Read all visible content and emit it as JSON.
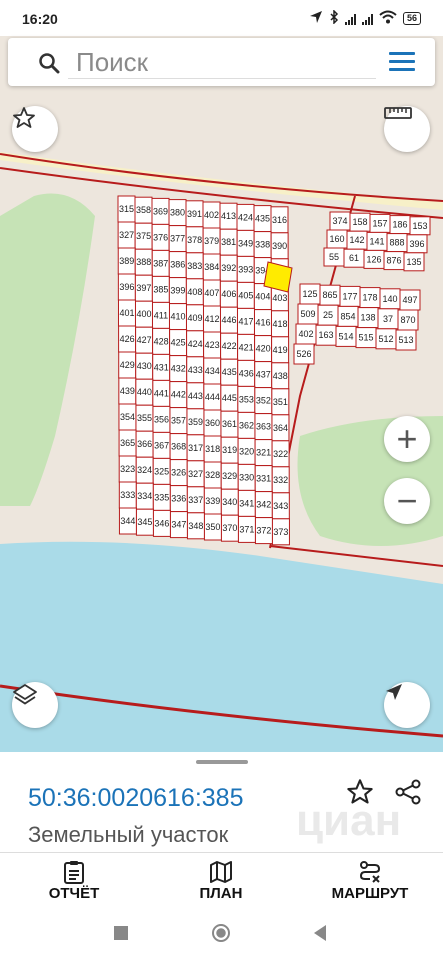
{
  "status": {
    "time": "16:20",
    "battery": "56"
  },
  "search": {
    "placeholder": "Поиск"
  },
  "map": {
    "zoom_in": "+",
    "zoom_out": "−",
    "parcels": [
      "315",
      "358",
      "369",
      "380",
      "391",
      "402",
      "413",
      "424",
      "435",
      "316",
      "327",
      "375",
      "376",
      "377",
      "378",
      "379",
      "381",
      "349",
      "338",
      "390",
      "389",
      "388",
      "387",
      "386",
      "383",
      "384",
      "392",
      "393",
      "394",
      "395",
      "396",
      "397",
      "385",
      "399",
      "408",
      "407",
      "406",
      "405",
      "404",
      "403",
      "401",
      "400",
      "411",
      "410",
      "409",
      "412",
      "446",
      "417",
      "416",
      "418",
      "426",
      "427",
      "428",
      "425",
      "424",
      "423",
      "422",
      "421",
      "420",
      "419",
      "429",
      "430",
      "431",
      "432",
      "433",
      "434",
      "435",
      "436",
      "437",
      "438",
      "439",
      "440",
      "441",
      "442",
      "443",
      "444",
      "445",
      "353",
      "352",
      "351",
      "354",
      "355",
      "356",
      "357",
      "359",
      "360",
      "361",
      "362",
      "363",
      "364",
      "365",
      "366",
      "367",
      "368",
      "317",
      "318",
      "319",
      "320",
      "321",
      "322",
      "323",
      "324",
      "325",
      "326",
      "327",
      "328",
      "329",
      "330",
      "331",
      "332",
      "333",
      "334",
      "335",
      "336",
      "337",
      "339",
      "340",
      "341",
      "342",
      "343",
      "344",
      "345",
      "346",
      "347",
      "348",
      "350",
      "370",
      "371",
      "372",
      "373",
      "374",
      "158",
      "157",
      "186",
      "153",
      "160",
      "142",
      "141",
      "888",
      "396",
      "55",
      "61",
      "126",
      "876",
      "135",
      "125",
      "865",
      "177",
      "178",
      "140",
      "497",
      "509",
      "25",
      "854",
      "138",
      "37",
      "870",
      "402",
      "163",
      "514",
      "515",
      "512",
      "513",
      "526"
    ]
  },
  "sheet": {
    "cadastral_number": "50:36:0020616:385",
    "type": "Земельный участок",
    "watermark": "циан"
  },
  "tabs": [
    {
      "label": "ОТЧЁТ",
      "icon": "report-icon"
    },
    {
      "label": "ПЛАН",
      "icon": "map-plan-icon"
    },
    {
      "label": "МАРШРУТ",
      "icon": "route-icon"
    }
  ],
  "colors": {
    "accent": "#1b73b8",
    "parcel_border": "#b71c1c",
    "water": "#aadbe8",
    "forest": "#c6e3b6",
    "land": "#ede6dd",
    "highlight": "#ffeb00"
  }
}
